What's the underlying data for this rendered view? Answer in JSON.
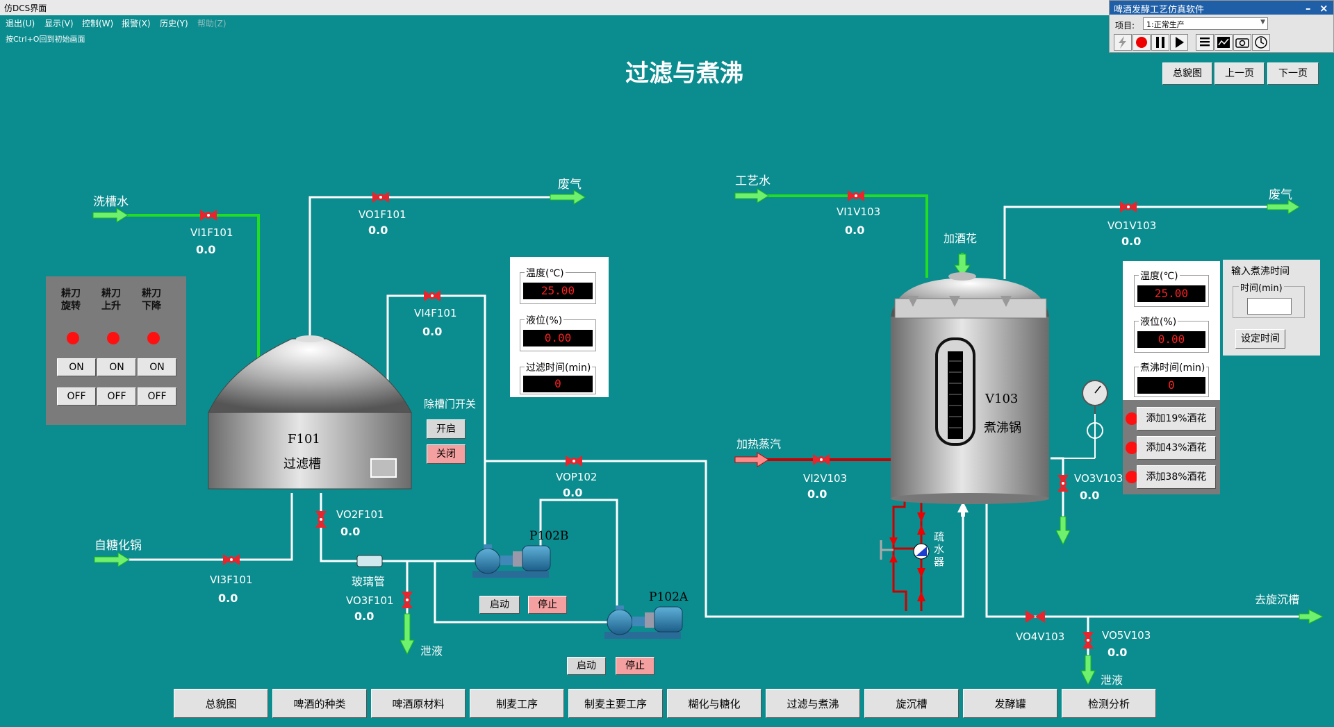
{
  "window": {
    "title": "仿DCS界面"
  },
  "menu": [
    {
      "label": "退出(U)"
    },
    {
      "label": "显示(V)"
    },
    {
      "label": "控制(W)"
    },
    {
      "label": "报警(X)"
    },
    {
      "label": "历史(Y)"
    },
    {
      "label": "帮助(Z)"
    }
  ],
  "hint": "按Ctrl+O回到初始画面",
  "sim": {
    "title": "啤酒发酵工艺仿真软件",
    "project_label": "项目:",
    "project_value": "1:正常生产"
  },
  "page_title": "过滤与煮沸",
  "nav": {
    "overview": "总貌图",
    "prev": "上一页",
    "next": "下一页"
  },
  "filter": {
    "label_wash_water": "洗槽水",
    "label_waste_gas": "废气",
    "label_from_mash": "自糖化锅",
    "label_glass": "玻璃管",
    "label_drain": "泄液",
    "tank_id": "F101",
    "tank_name": "过滤槽",
    "valves": [
      {
        "tag": "VI1F101",
        "value": "0.0"
      },
      {
        "tag": "VO1F101",
        "value": "0.0"
      },
      {
        "tag": "VI4F101",
        "value": "0.0"
      },
      {
        "tag": "VO2F101",
        "value": "0.0"
      },
      {
        "tag": "VI3F101",
        "value": "0.0"
      },
      {
        "tag": "VO3F101",
        "value": "0.0"
      },
      {
        "tag": "VOP102",
        "value": "0.0"
      }
    ],
    "rake_panel": {
      "cols": [
        "耕刀\n旋转",
        "耕刀\n上升",
        "耕刀\n下降"
      ],
      "on": "ON",
      "off": "OFF"
    },
    "grain_door": {
      "label": "除槽门开关",
      "open": "开启",
      "close": "关闭"
    },
    "info": {
      "temp_label": "温度(℃)",
      "temp": "25.00",
      "level_label": "液位(%)",
      "level": "0.00",
      "time_label": "过滤时间(min)",
      "time": "0"
    }
  },
  "pumps": [
    {
      "name": "P102B",
      "start": "启动",
      "stop": "停止"
    },
    {
      "name": "P102A",
      "start": "启动",
      "stop": "停止"
    }
  ],
  "boil": {
    "label_process_water": "工艺水",
    "label_waste_gas": "废气",
    "label_hops": "加酒花",
    "label_steam": "加热蒸汽",
    "label_to_whirlpool": "去旋沉槽",
    "label_drain": "泄液",
    "label_trap": "疏\n水\n器",
    "tank_id": "V103",
    "tank_name": "煮沸锅",
    "valves": [
      {
        "tag": "VI1V103",
        "value": "0.0"
      },
      {
        "tag": "VO1V103",
        "value": "0.0"
      },
      {
        "tag": "VI2V103",
        "value": "0.0"
      },
      {
        "tag": "VO3V103",
        "value": "0.0"
      },
      {
        "tag": "VO4V103",
        "value": ""
      },
      {
        "tag": "VO5V103",
        "value": "0.0"
      }
    ],
    "info": {
      "temp_label": "温度(℃)",
      "temp": "25.00",
      "level_label": "液位(%)",
      "level": "0.00",
      "time_label": "煮沸时间(min)",
      "time": "0"
    },
    "boil_time": {
      "title": "输入煮沸时间",
      "field_label": "时间(min)",
      "value": "",
      "button": "设定时间"
    },
    "hops_buttons": [
      "添加19%酒花",
      "添加43%酒花",
      "添加38%酒花"
    ]
  },
  "tabs": [
    "总貌图",
    "啤酒的种类",
    "啤酒原材料",
    "制麦工序",
    "制麦主要工序",
    "糊化与糖化",
    "过滤与煮沸",
    "旋沉槽",
    "发酵罐",
    "检测分析"
  ],
  "colors": {
    "background": "#0b8c8f",
    "green_pipe": "#22dd22",
    "white_pipe": "#ffffff",
    "steam_red": "#cc0000",
    "led_red": "#ff2020",
    "valve_red": "#e8242c"
  }
}
